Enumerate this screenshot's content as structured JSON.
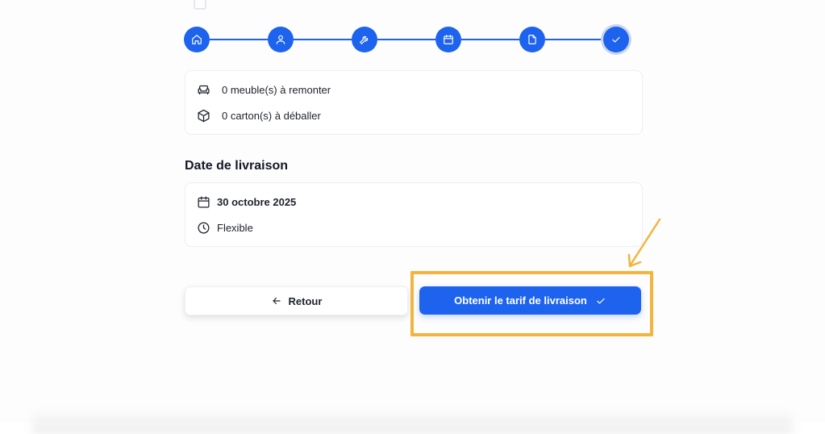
{
  "stepper": {
    "steps": [
      {
        "icon": "home-icon"
      },
      {
        "icon": "user-icon"
      },
      {
        "icon": "wrench-icon"
      },
      {
        "icon": "calendar-icon"
      },
      {
        "icon": "document-icon"
      },
      {
        "icon": "check-icon"
      }
    ],
    "color": "#1d63ee"
  },
  "services": {
    "items": [
      {
        "icon": "sofa-icon",
        "label": "0 meuble(s) à remonter"
      },
      {
        "icon": "box-icon",
        "label": "0 carton(s) à déballer"
      }
    ]
  },
  "delivery": {
    "title": "Date de livraison",
    "date": "30 octobre 2025",
    "date_icon": "calendar-icon",
    "flexibility": "Flexible",
    "flexibility_icon": "clock-icon"
  },
  "actions": {
    "back_label": "Retour",
    "back_icon": "arrow-left-icon",
    "submit_label": "Obtenir le tarif de livraison",
    "submit_icon": "check-icon"
  },
  "annotation": {
    "highlight_color": "#f3b43d"
  }
}
